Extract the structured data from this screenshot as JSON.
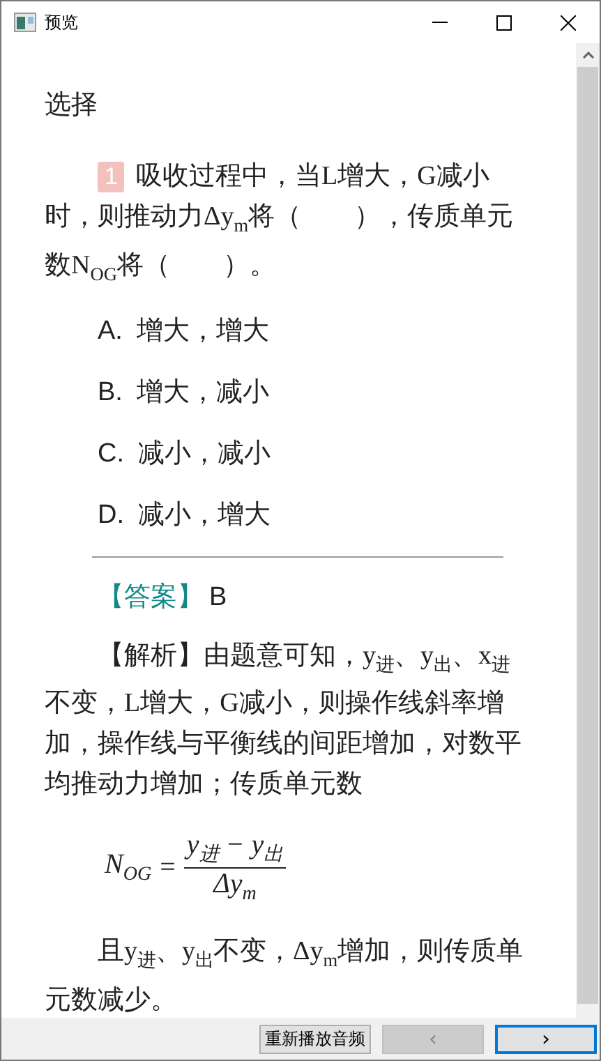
{
  "window": {
    "title": "预览"
  },
  "section_title": "选择",
  "question": {
    "number": "1",
    "text": "吸收过程中，当L增大，G减小时，则推动力Δy$_{m}$将（　　），传质单元数N$_{OG}$将（　　）。"
  },
  "options": [
    {
      "letter": "A.",
      "text": "增大，增大"
    },
    {
      "letter": "B.",
      "text": "增大，减小"
    },
    {
      "letter": "C.",
      "text": "减小，减小"
    },
    {
      "letter": "D.",
      "text": "减小，增大"
    }
  ],
  "answer": {
    "label": "【答案】",
    "value": "B"
  },
  "analysis": "【解析】由题意可知，y$_{进}$、y$_{出}$、x$_{进}$不变，L增大，G减小，则操作线斜率增加，操作线与平衡线的间距增加，对数平均推动力增加；传质单元数",
  "formula": {
    "lhs": "N$_{OG}$",
    "equals": "=",
    "numerator": "y$_{进}$ − y$_{出}$",
    "denominator": "Δy$_{m}$"
  },
  "conclusion": "且y$_{进}$、y$_{出}$不变，Δy$_{m}$增加，则传质单元数减少。",
  "buttons": [
    {
      "kind": "text",
      "label": "重新播放音频",
      "disabled": false,
      "focused": false
    },
    {
      "kind": "glyph",
      "label": "‹",
      "disabled": true,
      "focused": false
    },
    {
      "kind": "glyph",
      "label": "›",
      "disabled": false,
      "focused": true
    }
  ]
}
